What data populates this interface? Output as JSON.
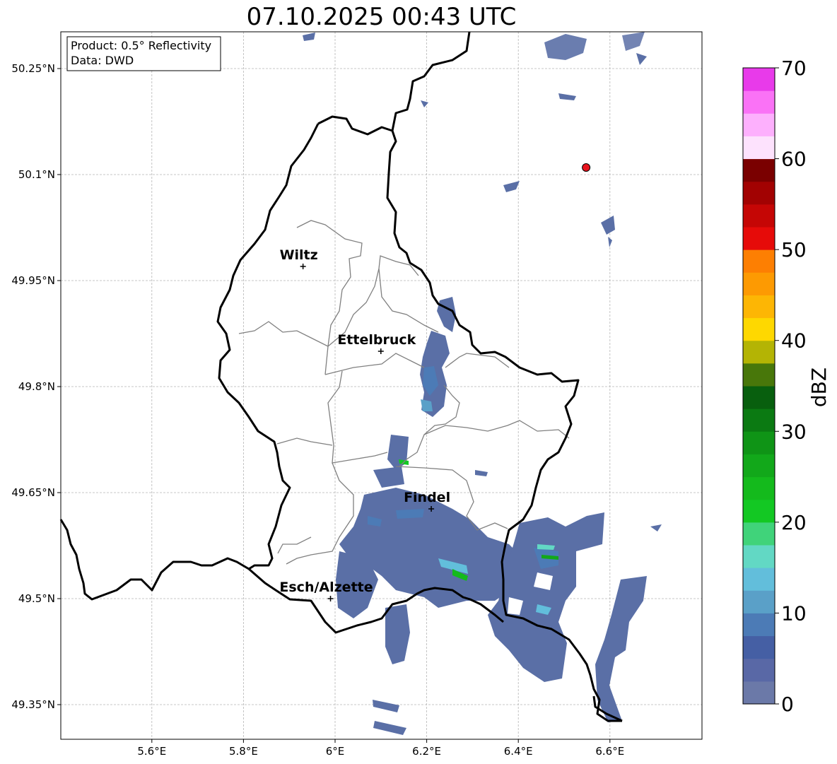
{
  "title": "07.10.2025 00:43 UTC",
  "info_box": {
    "product": "Product: 0.5° Reflectivity",
    "data": "Data: DWD"
  },
  "axes": {
    "lon_ticks": [
      "5.6°E",
      "5.8°E",
      "6°E",
      "6.2°E",
      "6.4°E",
      "6.6°E"
    ],
    "lon_values": [
      5.6,
      5.8,
      6.0,
      6.2,
      6.4,
      6.6
    ],
    "lat_ticks": [
      "50.25°N",
      "50.1°N",
      "49.95°N",
      "49.8°N",
      "49.65°N",
      "49.5°N",
      "49.35°N"
    ],
    "lat_values": [
      50.25,
      50.1,
      49.95,
      49.8,
      49.65,
      49.5,
      49.35
    ],
    "lon_range": [
      5.4,
      6.8
    ],
    "lat_range": [
      49.3,
      50.3
    ],
    "grid": true
  },
  "cities": [
    {
      "name": "Wiltz",
      "lon": 5.93,
      "lat": 49.97
    },
    {
      "name": "Ettelbruck",
      "lon": 6.1,
      "lat": 49.85
    },
    {
      "name": "Findel",
      "lon": 6.21,
      "lat": 49.627
    },
    {
      "name": "Esch/Alzette",
      "lon": 5.99,
      "lat": 49.5
    }
  ],
  "radar_site": {
    "lon": 6.548,
    "lat": 50.11,
    "color": "#e8141e"
  },
  "colorbar": {
    "label": "dBZ",
    "ticks": [
      "0",
      "10",
      "20",
      "30",
      "40",
      "50",
      "60",
      "70"
    ],
    "min": 0,
    "max": 70,
    "step": 2.5,
    "colors": [
      "#6b79a8",
      "#5968a6",
      "#455fa4",
      "#4c7bb6",
      "#5aa0c8",
      "#62bedb",
      "#62d8c4",
      "#40d37a",
      "#13c823",
      "#14ba1c",
      "#12a81a",
      "#0f9416",
      "#0b7a12",
      "#085f0e",
      "#48770a",
      "#b4b404",
      "#fed800",
      "#fdb604",
      "#fd9a02",
      "#fd7f02",
      "#e60b09",
      "#c50605",
      "#a20202",
      "#7a0000",
      "#fde2fd",
      "#fdb0fd",
      "#fa72f6",
      "#e83aea"
    ]
  },
  "echo_color": "#5a6fa6"
}
